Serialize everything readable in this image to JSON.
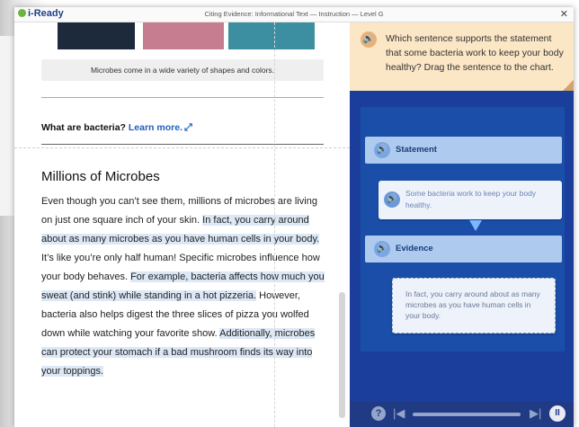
{
  "app": {
    "logo": "i-Ready",
    "title": "Citing Evidence: Informational Text — Instruction — Level G",
    "close": "✕"
  },
  "left": {
    "caption": "Microbes come in a wide variety of shapes and colors.",
    "question": "What are bacteria?",
    "learn_more": "Learn more.",
    "heading": "Millions of Microbes",
    "paragraph": [
      {
        "text": "Even though you can’t see them, millions of microbes are living on just one square inch of your skin. ",
        "highlight": false
      },
      {
        "text": "In fact, you carry around about as many microbes as you have human cells in your body.",
        "highlight": true
      },
      {
        "text": " It’s like you’re only half human! Specific microbes influence how your body behaves. ",
        "highlight": false
      },
      {
        "text": "For example, bacteria affects how much you sweat (and stink) while standing in a hot pizzeria.",
        "highlight": true
      },
      {
        "text": " However, bacteria also helps digest the three slices of pizza you wolfed down while watching your favorite show. ",
        "highlight": false
      },
      {
        "text": "Additionally, microbes can protect your stomach if a bad mushroom finds its way into your toppings.",
        "highlight": true
      }
    ]
  },
  "right": {
    "prompt": "Which sentence supports the statement that some bacteria work to keep your body healthy? Drag the sentence to the chart.",
    "statement_label": "Statement",
    "statement_text": "Some bacteria work to keep your body healthy.",
    "evidence_label": "Evidence",
    "evidence_text": "In fact, you carry around about as many microbes as you have human cells in your body.",
    "footer": {
      "help": "?",
      "pause": "II"
    }
  }
}
